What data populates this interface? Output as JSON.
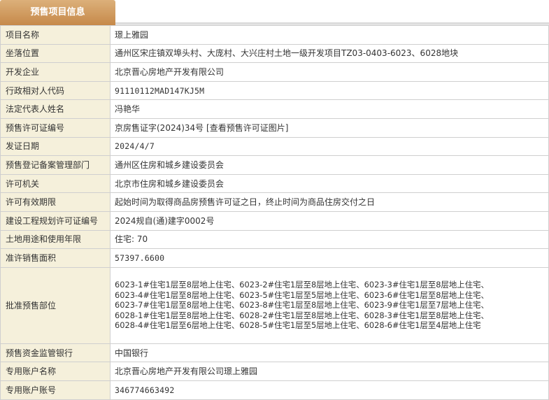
{
  "header": {
    "tab_title": "预售项目信息"
  },
  "rows": [
    {
      "label": "项目名称",
      "value": "璟上雅园"
    },
    {
      "label": "坐落位置",
      "value": "通州区宋庄镇双埠头村、大庞村、大兴庄村土地一级开发项目TZ03-0403-6023、6028地块"
    },
    {
      "label": "开发企业",
      "value": "北京晋心房地产开发有限公司"
    },
    {
      "label": "行政相对人代码",
      "value": "91110112MAD147KJ5M"
    },
    {
      "label": "法定代表人姓名",
      "value": "冯艳华"
    },
    {
      "label": "预售许可证编号",
      "value": "京房售证字(2024)34号",
      "link": "[查看预售许可证图片]"
    },
    {
      "label": "发证日期",
      "value": "2024/4/7"
    },
    {
      "label": "预售登记备案管理部门",
      "value": "通州区住房和城乡建设委员会"
    },
    {
      "label": "许可机关",
      "value": "北京市住房和城乡建设委员会"
    },
    {
      "label": "许可有效期限",
      "value": "起始时间为取得商品房预售许可证之日，终止时间为商品住房交付之日"
    },
    {
      "label": "建设工程规划许可证编号",
      "value": "2024规自(通)建字0002号"
    },
    {
      "label": "土地用途和使用年限",
      "value": "住宅: 70"
    },
    {
      "label": "准许销售面积",
      "value": "57397.6600"
    },
    {
      "label": "批准预售部位",
      "lines": [
        "6023-1#住宅1层至8层地上住宅、6023-2#住宅1层至8层地上住宅、6023-3#住宅1层至8层地上住宅、",
        "6023-4#住宅1层至8层地上住宅、6023-5#住宅1层至5层地上住宅、6023-6#住宅1层至8层地上住宅、",
        "6023-7#住宅1层至8层地上住宅、6023-8#住宅1层至8层地上住宅、6023-9#住宅1层至7层地上住宅、",
        "6028-1#住宅1层至8层地上住宅、6028-2#住宅1层至8层地上住宅、6028-3#住宅1层至8层地上住宅、",
        "6028-4#住宅1层至6层地上住宅、6028-5#住宅1层至5层地上住宅、6028-6#住宅1层至4层地上住宅"
      ]
    },
    {
      "label": "预售资金监管银行",
      "value": "中国银行"
    },
    {
      "label": "专用账户名称",
      "value": "北京晋心房地产开发有限公司璟上雅园"
    },
    {
      "label": "专用账户账号",
      "value": "346774663492"
    }
  ]
}
